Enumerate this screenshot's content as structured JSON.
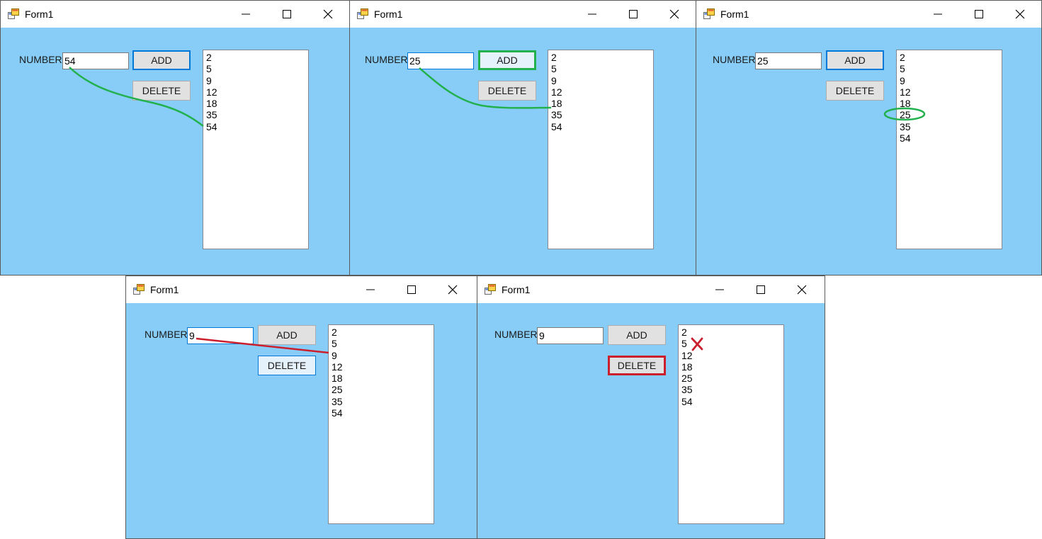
{
  "panels": [
    {
      "title": "Form1",
      "number_label": "NUMBER",
      "input_value": "54",
      "add_label": "ADD",
      "delete_label": "DELETE",
      "list_items": [
        "2",
        "5",
        "9",
        "12",
        "18",
        "35",
        "54"
      ]
    },
    {
      "title": "Form1",
      "number_label": "NUMBER",
      "input_value": "25",
      "add_label": "ADD",
      "delete_label": "DELETE",
      "list_items": [
        "2",
        "5",
        "9",
        "12",
        "18",
        "35",
        "54"
      ]
    },
    {
      "title": "Form1",
      "number_label": "NUMBER",
      "input_value": "25",
      "add_label": "ADD",
      "delete_label": "DELETE",
      "list_items": [
        "2",
        "5",
        "9",
        "12",
        "18",
        "25",
        "35",
        "54"
      ]
    },
    {
      "title": "Form1",
      "number_label": "NUMBER",
      "input_value": "9",
      "add_label": "ADD",
      "delete_label": "DELETE",
      "list_items": [
        "2",
        "5",
        "9",
        "12",
        "18",
        "25",
        "35",
        "54"
      ]
    },
    {
      "title": "Form1",
      "number_label": "NUMBER",
      "input_value": "9",
      "add_label": "ADD",
      "delete_label": "DELETE",
      "list_items": [
        "2",
        "5",
        "12",
        "18",
        "25",
        "35",
        "54"
      ]
    }
  ],
  "colors": {
    "client_background": "#87cdf8",
    "annotation_green": "#22b14c",
    "annotation_red": "#cc1f2e",
    "focus_blue": "#0078d7"
  }
}
